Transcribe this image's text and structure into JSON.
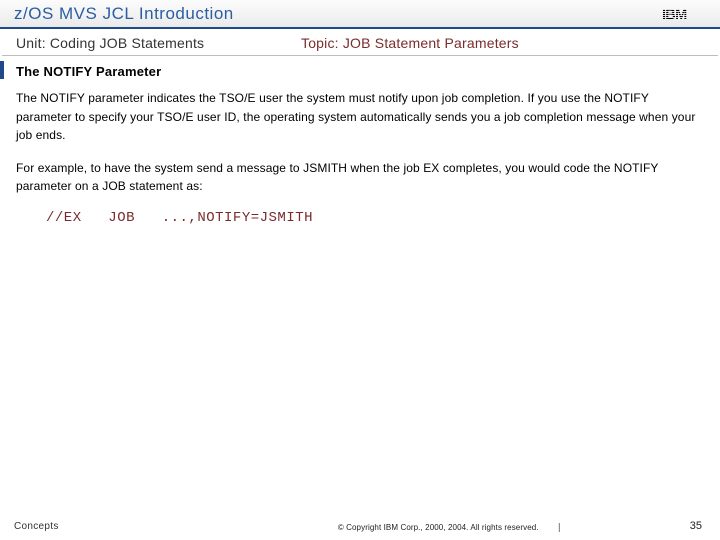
{
  "header": {
    "title": "z/OS MVS JCL Introduction",
    "logo_text": "IBM"
  },
  "subheader": {
    "unit_label": "Unit: Coding JOB Statements",
    "topic_label": "Topic: JOB Statement Parameters"
  },
  "body": {
    "section_heading": "The NOTIFY Parameter",
    "para1": "The NOTIFY parameter indicates the TSO/E user the system must notify upon job completion. If you use the NOTIFY parameter to specify your TSO/E user ID, the operating system automatically sends you a job completion message when your job ends.",
    "para2": "For example, to have the system send a message to JSMITH when the job EX completes, you would code the NOTIFY parameter on a JOB statement as:",
    "code": "//EX   JOB   ...,NOTIFY=JSMITH"
  },
  "footer": {
    "left": "Concepts",
    "center": "© Copyright IBM Corp., 2000, 2004. All rights reserved.",
    "page_number": "35"
  }
}
